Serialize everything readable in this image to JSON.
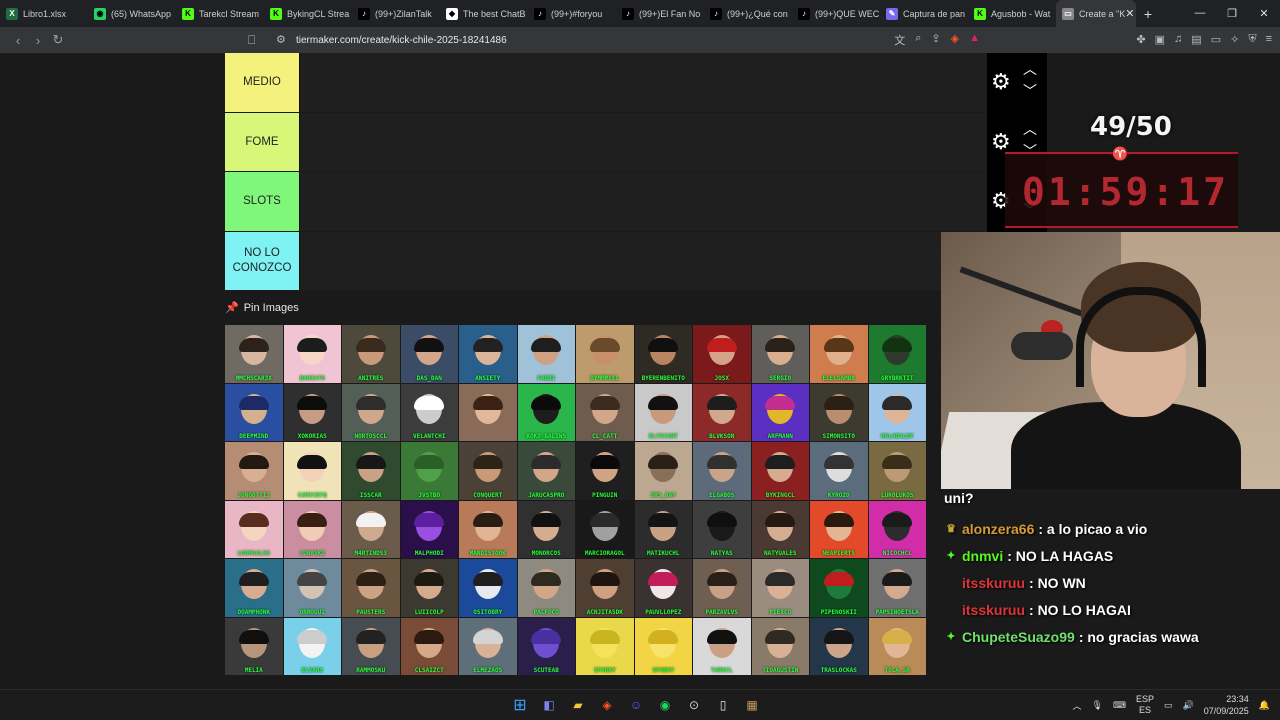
{
  "browser": {
    "tabs": [
      {
        "label": "Libro1.xlsx",
        "color": "#1d6f42",
        "glyph": "X"
      },
      {
        "label": "(65) WhatsApp",
        "color": "#25d366",
        "glyph": "◉"
      },
      {
        "label": "Tarekcl Stream",
        "color": "#53fc18",
        "glyph": "K"
      },
      {
        "label": "BykingCL Strea",
        "color": "#53fc18",
        "glyph": "K"
      },
      {
        "label": "(99+)ZilanTalk",
        "color": "#000000",
        "glyph": "♪"
      },
      {
        "label": "The best ChatB",
        "color": "#ffffff",
        "glyph": "◆"
      },
      {
        "label": "(99+)#foryou",
        "color": "#000000",
        "glyph": "♪"
      },
      {
        "label": "(99+)El Fan No",
        "color": "#000000",
        "glyph": "♪"
      },
      {
        "label": "(99+)¿Qué con",
        "color": "#000000",
        "glyph": "♪"
      },
      {
        "label": "(99+)QUE WEC",
        "color": "#000000",
        "glyph": "♪"
      },
      {
        "label": "Captura de pan",
        "color": "#7b68ee",
        "glyph": "✎"
      },
      {
        "label": "Agusbob - Wat",
        "color": "#53fc18",
        "glyph": "K"
      },
      {
        "label": "Create a \"K",
        "color": "#888888",
        "glyph": "▭"
      }
    ],
    "url": "tiermaker.com/create/kick-chile-2025-18241486"
  },
  "tiers": [
    {
      "label": "MEDIO",
      "color": "#f4f27c"
    },
    {
      "label": "FOME",
      "color": "#d8f779"
    },
    {
      "label": "SLOTS",
      "color": "#7ef77b"
    },
    {
      "label": "NO LO CONOZCO",
      "color": "#7ff2f4"
    }
  ],
  "pin_header": "Pin Images",
  "images": [
    {
      "cap": "MMCHSCAR3X",
      "bg": "#6f6a62",
      "skin": "#d8b7a0",
      "hair": "#2b221b"
    },
    {
      "cap": "BAHIATO",
      "bg": "#f1c4d3",
      "skin": "#f6d8c8",
      "hair": "#1c1c1c"
    },
    {
      "cap": "ANITRES",
      "bg": "#4d4a3b",
      "skin": "#c89a7a",
      "hair": "#3a2a1e"
    },
    {
      "cap": "DAS_DAN",
      "bg": "#3b4d66",
      "skin": "#d2a789",
      "hair": "#111"
    },
    {
      "cap": "ANSIETY",
      "bg": "#2a5f8c",
      "skin": "#d9b59a",
      "hair": "#222"
    },
    {
      "cap": "FABRI",
      "bg": "#9fc2d8",
      "skin": "#cfa081",
      "hair": "#1e1e1e"
    },
    {
      "cap": "BYMMMCEL",
      "bg": "#bd9b6c",
      "skin": "#c98f6c",
      "hair": "#6b4a2c"
    },
    {
      "cap": "BYERENBENITO",
      "bg": "#2e2a24",
      "skin": "#b88462",
      "hair": "#0f0f0f"
    },
    {
      "cap": "JOSX",
      "bg": "#7b1a1a",
      "skin": "#d5a287",
      "hair": "#c21d1d"
    },
    {
      "cap": "SERGIO",
      "bg": "#5f5e5a",
      "skin": "#d9ad90",
      "hair": "#2a2218"
    },
    {
      "cap": "ELELGAMBR",
      "bg": "#cf7d4e",
      "skin": "#e0b18c",
      "hair": "#5a3618"
    },
    {
      "cap": "GRYBRKTIT",
      "bg": "#1e7a2e",
      "skin": "#2e3a2e",
      "hair": "#113311"
    },
    {
      "cap": "DEEPMIND",
      "bg": "#2a4ea0",
      "skin": "#d4b08f",
      "hair": "#1c2a66"
    },
    {
      "cap": "XOKORIAS",
      "bg": "#2f2f2f",
      "skin": "#c49d82",
      "hair": "#0c0c0c"
    },
    {
      "cap": "NORTOSCCL",
      "bg": "#525e56",
      "skin": "#cfa78a",
      "hair": "#2d2d2d"
    },
    {
      "cap": "VELANTCHI",
      "bg": "#3c3c3c",
      "skin": "#cccccc",
      "hair": "#ffffff"
    },
    {
      "cap": "",
      "bg": "#8a6a58",
      "skin": "#e2b89a",
      "hair": "#3b2214"
    },
    {
      "cap": "KOKO_BALIWS",
      "bg": "#2bb64c",
      "skin": "#1d1d1d",
      "hair": "#0b0b0b"
    },
    {
      "cap": "CL_CATT",
      "bg": "#6e5c4e",
      "skin": "#d2a789",
      "hair": "#3c2c20"
    },
    {
      "cap": "ELYICANT",
      "bg": "#c9c9c9",
      "skin": "#c79a7c",
      "hair": "#111"
    },
    {
      "cap": "BLVKSON",
      "bg": "#8c2a2a",
      "skin": "#d0a98c",
      "hair": "#1d1d1d"
    },
    {
      "cap": "ARFMANN",
      "bg": "#5a2fc2",
      "skin": "#e1b628",
      "hair": "#c22d8f"
    },
    {
      "cap": "SIMONSITO",
      "bg": "#3d3a30",
      "skin": "#b98d70",
      "hair": "#2a2016"
    },
    {
      "cap": "MALADALDY",
      "bg": "#9ec6e8",
      "skin": "#dcb498",
      "hair": "#2a2a2a"
    },
    {
      "cap": "JONGOTTII",
      "bg": "#b58d75",
      "skin": "#d9ae92",
      "hair": "#221a12"
    },
    {
      "cap": "CAMICBTQ",
      "bg": "#f0e3b8",
      "skin": "#f2d2b8",
      "hair": "#111111"
    },
    {
      "cap": "ISSCAR",
      "bg": "#2f4a2e",
      "skin": "#c9a184",
      "hair": "#171717"
    },
    {
      "cap": "JVSTBO",
      "bg": "#3a7a36",
      "skin": "#4fa04a",
      "hair": "#2a5f27"
    },
    {
      "cap": "CONQUERT",
      "bg": "#4a4236",
      "skin": "#c89a7a",
      "hair": "#2d2418"
    },
    {
      "cap": "JARUCASPRO",
      "bg": "#3a4a3a",
      "skin": "#d2a68a",
      "hair": "#2b2b2b"
    },
    {
      "cap": "PINGUIN",
      "bg": "#1f1f1f",
      "skin": "#cfa385",
      "hair": "#0a0a0a"
    },
    {
      "cap": "SRS_RAY",
      "bg": "#bca791",
      "skin": "#8a6f58",
      "hair": "#2a2018"
    },
    {
      "cap": "ELGABOS",
      "bg": "#5c6a7a",
      "skin": "#c9a38a",
      "hair": "#30302e"
    },
    {
      "cap": "BYKINGCL",
      "bg": "#8a2020",
      "skin": "#d6ac90",
      "hair": "#1e1e1e"
    },
    {
      "cap": "KYROZO",
      "bg": "#5b6d7d",
      "skin": "#dedede",
      "hair": "#333333"
    },
    {
      "cap": "LUKOLUKOS",
      "bg": "#7a6a42",
      "skin": "#bd9a76",
      "hair": "#3a2e1a"
    },
    {
      "cap": "LUUMAALSS",
      "bg": "#e8b6c5",
      "skin": "#f3d4c0",
      "hair": "#5a2b1f"
    },
    {
      "cap": "LUNASKZ",
      "bg": "#c98ea0",
      "skin": "#f0ccb6",
      "hair": "#3a1e14"
    },
    {
      "cap": "M4RTINDS3",
      "bg": "#6b5b4b",
      "skin": "#cfa98d",
      "hair": "#f2f2f2"
    },
    {
      "cap": "MALPHODI",
      "bg": "#2a0f4a",
      "skin": "#9a4fe0",
      "hair": "#5b1fa0"
    },
    {
      "cap": "MANDISTOOK",
      "bg": "#b87a58",
      "skin": "#e2b493",
      "hair": "#2a1e14"
    },
    {
      "cap": "MONORCOS",
      "bg": "#303030",
      "skin": "#d6ac8e",
      "hair": "#111"
    },
    {
      "cap": "MARCIORAGOL",
      "bg": "#191919",
      "skin": "#a0a0a0",
      "hair": "#2a2a2a"
    },
    {
      "cap": "MATIKUCHL",
      "bg": "#2c2c2c",
      "skin": "#c8a185",
      "hair": "#141414"
    },
    {
      "cap": "NATYAS",
      "bg": "#3e3e3e",
      "skin": "#1a1a1a",
      "hair": "#0f0f0f"
    },
    {
      "cap": "NATYUALES",
      "bg": "#4a3a33",
      "skin": "#d7ad92",
      "hair": "#241a12"
    },
    {
      "cap": "NEAPIERTS",
      "bg": "#e24a2a",
      "skin": "#e2b595",
      "hair": "#2a1a10"
    },
    {
      "cap": "NICOCHCL",
      "bg": "#d12da8",
      "skin": "#2c2c2c",
      "hair": "#1a1a1a"
    },
    {
      "cap": "OOAMPHONK",
      "bg": "#2a6e8a",
      "skin": "#d7ad92",
      "hair": "#1f1f1f"
    },
    {
      "cap": "ORROGUI",
      "bg": "#6e8b9e",
      "skin": "#d2c3b4",
      "hair": "#444"
    },
    {
      "cap": "PAUSTERS",
      "bg": "#6a5640",
      "skin": "#cda385",
      "hair": "#2c1f14"
    },
    {
      "cap": "LUIICOLP",
      "bg": "#3c3a30",
      "skin": "#d5aa8c",
      "hair": "#1d1a12"
    },
    {
      "cap": "OSITOBRY",
      "bg": "#1c4a9a",
      "skin": "#e8e8f0",
      "hair": "#1f1f1f"
    },
    {
      "cap": "PALFOCO",
      "bg": "#8e8a80",
      "skin": "#d2a787",
      "hair": "#2f2a20"
    },
    {
      "cap": "ACNJITASDK",
      "bg": "#4f3f33",
      "skin": "#cf9f7f",
      "hair": "#1e1510"
    },
    {
      "cap": "PAUVLLOPEZ",
      "bg": "#3a3230",
      "skin": "#f0e6ea",
      "hair": "#c21d5a"
    },
    {
      "cap": "PARZAVLVS",
      "bg": "#6e5f52",
      "skin": "#c8a086",
      "hair": "#282018"
    },
    {
      "cap": "PIEXCO",
      "bg": "#9a8c7e",
      "skin": "#d8b196",
      "hair": "#2a2a2a"
    },
    {
      "cap": "PIPENOSKII",
      "bg": "#0f4a1e",
      "skin": "#1e7a3a",
      "hair": "#c21d1d"
    },
    {
      "cap": "PAPSINOETSLA",
      "bg": "#6f6f6f",
      "skin": "#d3aa8e",
      "hair": "#1a1a1a"
    },
    {
      "cap": "MELIA",
      "bg": "#3a3a3a",
      "skin": "#b89478",
      "hair": "#0f0f0f"
    },
    {
      "cap": "ELVANS",
      "bg": "#7ad0e8",
      "skin": "#f3f3f3",
      "hair": "#cccccc"
    },
    {
      "cap": "RAMMOSKU",
      "bg": "#454c52",
      "skin": "#c99f82",
      "hair": "#222222"
    },
    {
      "cap": "CLSAIZCT",
      "bg": "#7a4c38",
      "skin": "#d5a889",
      "hair": "#2a1a10"
    },
    {
      "cap": "ELMEZAOS",
      "bg": "#5f6f7a",
      "skin": "#d8b296",
      "hair": "#d4d4d4"
    },
    {
      "cap": "SCUTEAB",
      "bg": "#2a1f4a",
      "skin": "#6e4fd0",
      "hair": "#4a2fa0"
    },
    {
      "cap": "SPARKY",
      "bg": "#e8d84a",
      "skin": "#f5e25a",
      "hair": "#c9b51f"
    },
    {
      "cap": "SPARKY",
      "bg": "#f2d544",
      "skin": "#f8e36a",
      "hair": "#d2b01f"
    },
    {
      "cap": "TARKCL",
      "bg": "#d9d9d9",
      "skin": "#c9a084",
      "hair": "#111111"
    },
    {
      "cap": "TIOAGUSTIN",
      "bg": "#8a7a6a",
      "skin": "#d7b096",
      "hair": "#2f2a22"
    },
    {
      "cap": "TRASLOCKAS",
      "bg": "#23364a",
      "skin": "#cda48a",
      "hair": "#151515"
    },
    {
      "cap": "TOLA_SR",
      "bg": "#b88b58",
      "skin": "#e0b694",
      "hair": "#d8b04a"
    }
  ],
  "overlay": {
    "counter": "49/50",
    "timer": "01:59:17"
  },
  "stream_text": "uni?",
  "chat": [
    {
      "user": "alonzera66",
      "text": ": a lo picao a vio",
      "user_color": "#d69a3a",
      "badge": "♛",
      "badge_color": "#c8a23a"
    },
    {
      "user": "dnmvi",
      "text": ": NO LA HAGAS",
      "user_color": "#53fc18",
      "badge": "✦",
      "badge_color": "#53fc18"
    },
    {
      "user": "itsskuruu",
      "text": ": NO WN",
      "user_color": "#e0343a",
      "badge": "",
      "badge_color": "#e0343a"
    },
    {
      "user": "itsskuruu",
      "text": ": NO LO HAGAI",
      "user_color": "#e0343a",
      "badge": "",
      "badge_color": "#e0343a"
    },
    {
      "user": "ChupeteSuazo99",
      "text": ": no gracias wawa",
      "user_color": "#6fe06b",
      "badge": "✦",
      "badge_color": "#53fc18"
    }
  ],
  "taskbar": {
    "lang_top": "ESP",
    "lang_bottom": "ES",
    "time": "23:34",
    "date": "07/09/2025"
  }
}
